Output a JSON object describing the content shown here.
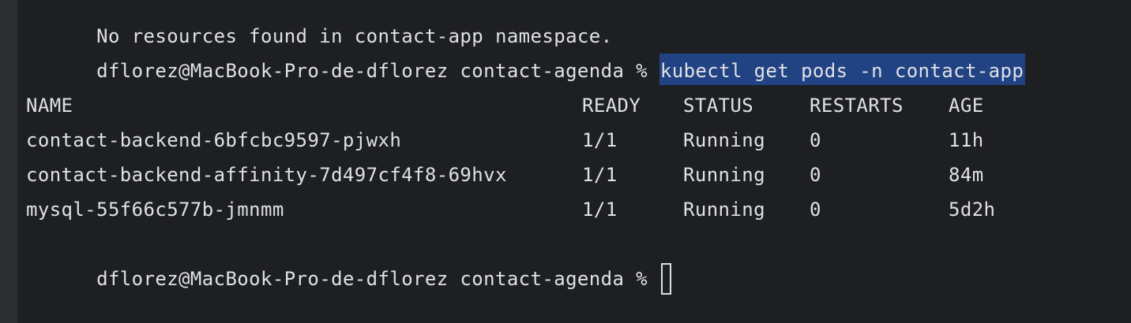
{
  "terminal": {
    "previous_output": "No resources found in contact-app namespace.",
    "prompt": "dflorez@MacBook-Pro-de-dflorez contact-agenda % ",
    "command": "kubectl get pods -n contact-app",
    "table": {
      "headers": {
        "name": "NAME",
        "ready": "READY",
        "status": "STATUS",
        "restarts": "RESTARTS",
        "age": "AGE"
      },
      "rows": [
        {
          "name": "contact-backend-6bfcbc9597-pjwxh",
          "ready": "1/1",
          "status": "Running",
          "restarts": "0",
          "age": "11h"
        },
        {
          "name": "contact-backend-affinity-7d497cf4f8-69hvx",
          "ready": "1/1",
          "status": "Running",
          "restarts": "0",
          "age": "84m"
        },
        {
          "name": "mysql-55f66c577b-jmnmm",
          "ready": "1/1",
          "status": "Running",
          "restarts": "0",
          "age": "5d2h"
        }
      ]
    }
  },
  "colors": {
    "background": "#1e1f22",
    "gutter": "#2b2d30",
    "text": "#dfe1e5",
    "selection": "#214283"
  }
}
